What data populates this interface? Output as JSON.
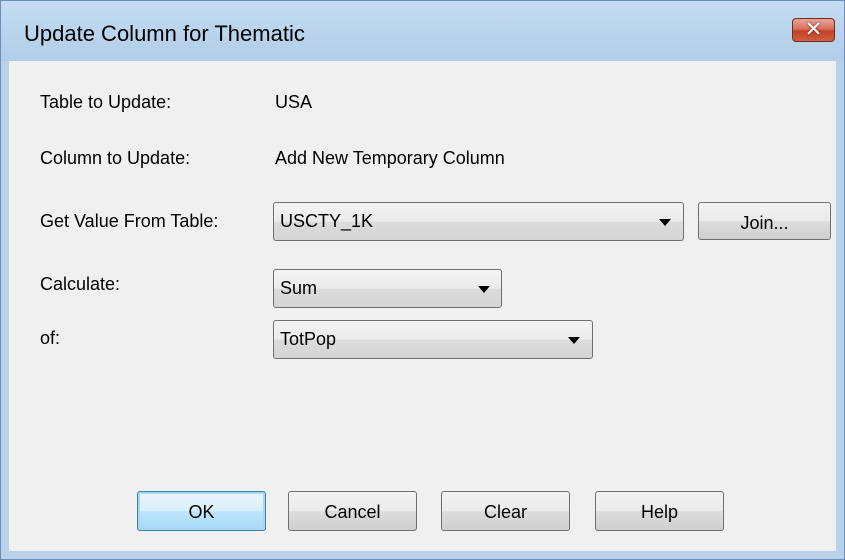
{
  "window": {
    "title": "Update Column for Thematic",
    "close_symbol": "✕"
  },
  "form": {
    "table_to_update_label": "Table to Update:",
    "table_to_update_value": "USA",
    "column_to_update_label": "Column to Update:",
    "column_to_update_value": "Add New Temporary Column",
    "get_value_label": "Get Value From Table:",
    "get_value_selected": "USCTY_1K",
    "join_label": "Join...",
    "calculate_label": "Calculate:",
    "calculate_selected": "Sum",
    "of_label": "of:",
    "of_selected": "TotPop"
  },
  "buttons": {
    "ok": "OK",
    "cancel": "Cancel",
    "clear": "Clear",
    "help": "Help"
  },
  "icons": {
    "close": "close-icon",
    "dropdown": "chevron-down-icon"
  }
}
